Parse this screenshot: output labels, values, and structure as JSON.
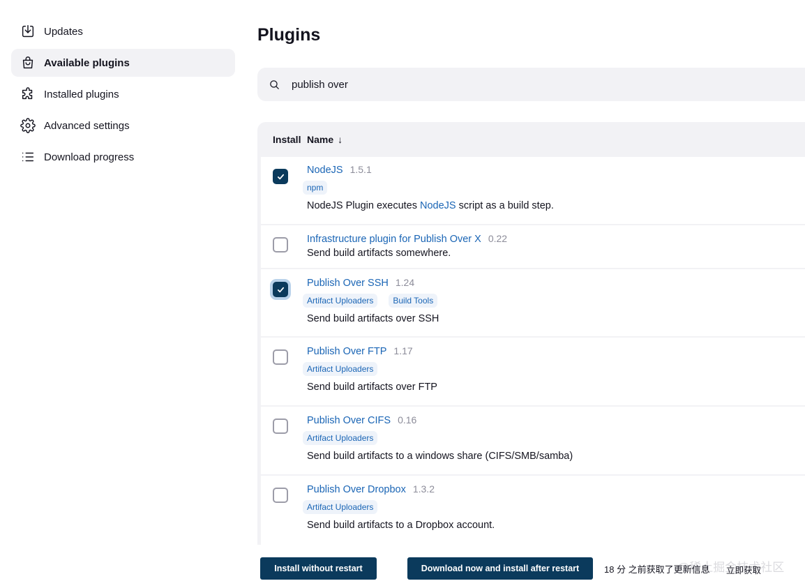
{
  "sidebar": {
    "items": [
      {
        "label": "Updates",
        "icon": "download-icon",
        "active": false
      },
      {
        "label": "Available plugins",
        "icon": "shopping-bag-icon",
        "active": true
      },
      {
        "label": "Installed plugins",
        "icon": "puzzle-icon",
        "active": false
      },
      {
        "label": "Advanced settings",
        "icon": "gear-icon",
        "active": false
      },
      {
        "label": "Download progress",
        "icon": "list-icon",
        "active": false
      }
    ]
  },
  "main": {
    "title": "Plugins",
    "search": {
      "value": "publish over",
      "icon": "search-icon"
    },
    "table": {
      "headers": {
        "install": "Install",
        "name": "Name",
        "sort_arrow": "↓"
      },
      "rows": [
        {
          "name": "NodeJS",
          "version": "1.5.1",
          "tags": [
            "npm"
          ],
          "desc_pre": "NodeJS Plugin executes ",
          "desc_link": "NodeJS",
          "desc_post": " script as a build step.",
          "checked": true
        },
        {
          "name": "Infrastructure plugin for Publish Over X",
          "version": "0.22",
          "tags": [],
          "desc_pre": "Send build artifacts somewhere.",
          "desc_link": "",
          "desc_post": "",
          "checked": false
        },
        {
          "name": "Publish Over SSH",
          "version": "1.24",
          "tags": [
            "Artifact Uploaders",
            "Build Tools"
          ],
          "desc_pre": "Send build artifacts over SSH",
          "desc_link": "",
          "desc_post": "",
          "checked": true
        },
        {
          "name": "Publish Over FTP",
          "version": "1.17",
          "tags": [
            "Artifact Uploaders"
          ],
          "desc_pre": "Send build artifacts over FTP",
          "desc_link": "",
          "desc_post": "",
          "checked": false
        },
        {
          "name": "Publish Over CIFS",
          "version": "0.16",
          "tags": [
            "Artifact Uploaders"
          ],
          "desc_pre": "Send build artifacts to a windows share (CIFS/SMB/samba)",
          "desc_link": "",
          "desc_post": "",
          "checked": false
        },
        {
          "name": "Publish Over Dropbox",
          "version": "1.3.2",
          "tags": [
            "Artifact Uploaders"
          ],
          "desc_pre": "Send build artifacts to a Dropbox account.",
          "desc_link": "",
          "desc_post": "",
          "checked": false
        }
      ]
    }
  },
  "bottom": {
    "install_without_restart": "Install without restart",
    "download_after_restart": "Download now and install after restart",
    "status": "18 分 之前获取了更新信息",
    "refresh": "立即获取",
    "watermark": "@稀土掘金技术社区"
  },
  "colors": {
    "accent": "#0b3a5c",
    "link": "#1a65b5",
    "panel": "#f2f2f5"
  }
}
